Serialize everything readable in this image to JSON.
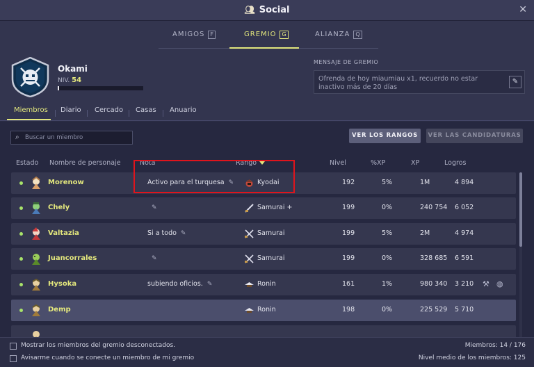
{
  "window": {
    "title": "Social"
  },
  "top_tabs": [
    {
      "label": "AMIGOS",
      "key": "F"
    },
    {
      "label": "GREMIO",
      "key": "G"
    },
    {
      "label": "ALIANZA",
      "key": "Q"
    }
  ],
  "guild": {
    "name": "Okami",
    "level_label": "NIV.",
    "level": "54",
    "xp_progress": 0.02,
    "message_label": "MENSAJE DE GREMIO",
    "message": "Ofrenda de hoy miaumiau x1, recuerdo no estar inactivo más de 20 días"
  },
  "sub_tabs": [
    "Miembros",
    "Diario",
    "Cercado",
    "Casas",
    "Anuario"
  ],
  "search": {
    "placeholder": "Buscar un miembro"
  },
  "buttons": {
    "ver_rangos": "VER LOS RANGOS",
    "ver_candidaturas": "VER LAS CANDIDATURAS"
  },
  "columns": {
    "estado": "Estado",
    "nombre": "Nombre de personaje",
    "nota": "Nota",
    "rango": "Rango",
    "nivel": "Nivel",
    "pxp": "%XP",
    "xp": "XP",
    "logros": "Logros"
  },
  "members": [
    {
      "name": "Morenow",
      "note": "Activo para  el turquesa",
      "rank": "Kyodai",
      "level": "192",
      "pxp": "5%",
      "xp": "1M",
      "logros": "4 894"
    },
    {
      "name": "Chely",
      "note": "",
      "rank": "Samurai +",
      "level": "199",
      "pxp": "0%",
      "xp": "240 754",
      "logros": "6 052"
    },
    {
      "name": "Valtazia",
      "note": "Si a todo",
      "rank": "Samurai",
      "level": "199",
      "pxp": "5%",
      "xp": "2M",
      "logros": "4 974"
    },
    {
      "name": "Juancorrales",
      "note": "",
      "rank": "Samurai",
      "level": "199",
      "pxp": "0%",
      "xp": "328 685",
      "logros": "6 591"
    },
    {
      "name": "Hysoka",
      "note": "subiendo oficios.",
      "rank": "Ronin",
      "level": "161",
      "pxp": "1%",
      "xp": "980 340",
      "logros": "3 210"
    },
    {
      "name": "Demp",
      "note": "",
      "rank": "Ronin",
      "level": "198",
      "pxp": "0%",
      "xp": "225 529",
      "logros": "5 710"
    }
  ],
  "footer": {
    "show_offline": "Mostrar los miembros del gremio desconectados.",
    "notify_connect": "Avisarme cuando se conecte un miembro de mi gremio",
    "members_count": "Miembros: 14 / 176",
    "avg_level": "Nivel medio de los miembros: 125"
  },
  "colors": {
    "accent": "#e3e77d",
    "online": "#a8e36a",
    "highlight_box": "#e0141c"
  }
}
